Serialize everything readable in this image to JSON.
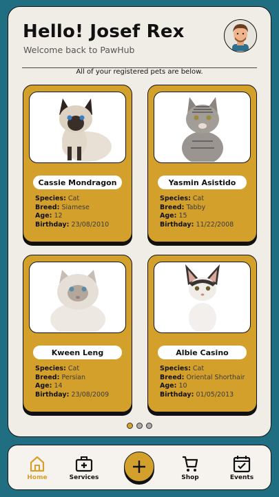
{
  "header": {
    "greeting": "Hello! Josef Rex",
    "welcome": "Welcome back to PawHub",
    "avatar_icon": "user-avatar"
  },
  "section_label": "All of your registered pets are below.",
  "labels": {
    "species": "Species:",
    "breed": "Breed:",
    "age": "Age:",
    "birthday": "Birthday:"
  },
  "pets": [
    {
      "name": "Cassie Mondragon",
      "species": "Cat",
      "breed": "Siamese",
      "age": "12",
      "birthday": "23/08/2010"
    },
    {
      "name": "Yasmin Asistido",
      "species": "Cat",
      "breed": "Tabby",
      "age": "15",
      "birthday": "11/22/2008"
    },
    {
      "name": "Kween Leng",
      "species": "Cat",
      "breed": "Persian",
      "age": "14",
      "birthday": "23/08/2009"
    },
    {
      "name": "Albie Casino",
      "species": "Cat",
      "breed": "Oriental Shorthair",
      "age": "10",
      "birthday": "01/05/2013"
    }
  ],
  "pagination": {
    "current": 1,
    "total": 3
  },
  "nav": {
    "home": "Home",
    "services": "Services",
    "shop": "Shop",
    "events": "Events",
    "add_icon": "plus-icon"
  },
  "colors": {
    "accent": "#d4a02c",
    "background": "#1f6e82",
    "surface": "#f0ece6"
  }
}
